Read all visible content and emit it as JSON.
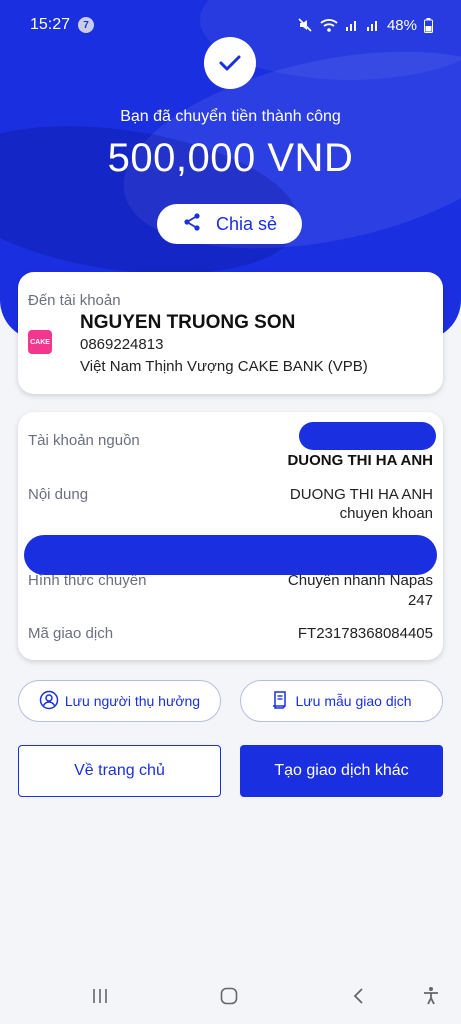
{
  "status_bar": {
    "time": "15:27",
    "notification_count": "7",
    "battery": "48%"
  },
  "hero": {
    "success_text": "Bạn đã chuyển tiền thành công",
    "amount": "500,000 VND",
    "share_label": "Chia sẻ"
  },
  "destination": {
    "label": "Đến tài khoản",
    "bank_logo_text": "CAKE",
    "name": "NGUYEN TRUONG SON",
    "account": "0869224813",
    "bank": "Việt Nam Thịnh Vượng CAKE BANK (VPB)"
  },
  "details": {
    "source_label": "Tài khoản nguồn",
    "source_name": "DUONG THI HA ANH",
    "content_label": "Nội dung",
    "content_line1": "DUONG THI HA ANH",
    "content_line2": "chuyen khoan",
    "method_label": "Hình thức chuyển",
    "method_line1": "Chuyển nhanh Napas",
    "method_line2": "247",
    "txn_label": "Mã giao dịch",
    "txn_value": "FT23178368084405"
  },
  "actions": {
    "save_payee": "Lưu người thụ hưởng",
    "save_template": "Lưu mẫu giao dịch",
    "home": "Về trang chủ",
    "new_transaction": "Tạo giao dịch khác"
  },
  "colors": {
    "brand": "#1a2fe0",
    "cake_pink": "#f4378e",
    "background": "#f4f5f9"
  }
}
